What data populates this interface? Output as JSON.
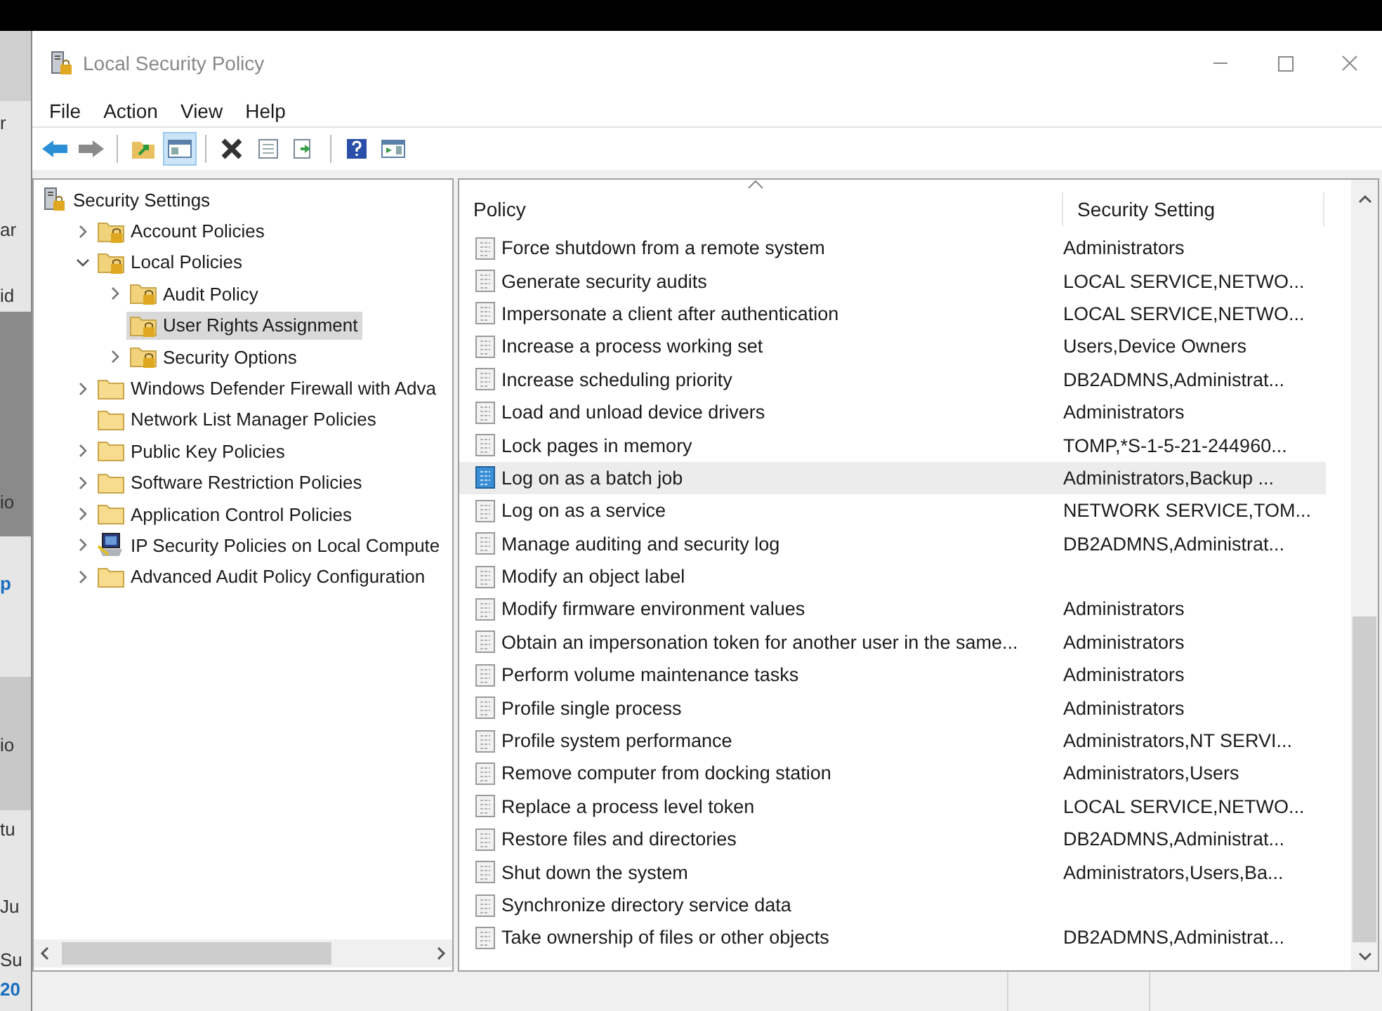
{
  "background_window": {
    "texts": [
      "r",
      "ar",
      "id",
      "io",
      "p",
      "io",
      "tu",
      "Ju",
      "Su",
      "20"
    ]
  },
  "window": {
    "title": "Local Security Policy"
  },
  "menu": [
    "File",
    "Action",
    "View",
    "Help"
  ],
  "toolbar": [
    {
      "kind": "back",
      "pressed": false
    },
    {
      "kind": "forward",
      "pressed": false
    },
    {
      "kind": "sep"
    },
    {
      "kind": "up",
      "pressed": false
    },
    {
      "kind": "tree",
      "pressed": true
    },
    {
      "kind": "sep"
    },
    {
      "kind": "delete",
      "pressed": false
    },
    {
      "kind": "properties",
      "pressed": false
    },
    {
      "kind": "export",
      "pressed": false
    },
    {
      "kind": "sep"
    },
    {
      "kind": "help",
      "pressed": false
    },
    {
      "kind": "pane",
      "pressed": false
    }
  ],
  "tree": [
    {
      "label": "Security Settings",
      "kind": "root",
      "selected": false,
      "children": [
        {
          "label": "Account Policies",
          "kind": "locked",
          "expanded": false,
          "selected": false
        },
        {
          "label": "Local Policies",
          "kind": "locked",
          "expanded": true,
          "selected": false,
          "children": [
            {
              "label": "Audit Policy",
              "kind": "locked",
              "expanded": false,
              "selected": false
            },
            {
              "label": "User Rights Assignment",
              "kind": "locked",
              "selected": true
            },
            {
              "label": "Security Options",
              "kind": "locked",
              "expanded": false,
              "selected": false
            }
          ]
        },
        {
          "label": "Windows Defender Firewall with Adva",
          "kind": "folder",
          "expanded": false,
          "selected": false
        },
        {
          "label": "Network List Manager Policies",
          "kind": "folder",
          "selected": false
        },
        {
          "label": "Public Key Policies",
          "kind": "folder",
          "expanded": false,
          "selected": false
        },
        {
          "label": "Software Restriction Policies",
          "kind": "folder",
          "expanded": false,
          "selected": false
        },
        {
          "label": "Application Control Policies",
          "kind": "folder",
          "expanded": false,
          "selected": false
        },
        {
          "label": "IP Security Policies on Local Compute",
          "kind": "ipsec",
          "expanded": false,
          "selected": false
        },
        {
          "label": "Advanced Audit Policy Configuration",
          "kind": "folder",
          "expanded": false,
          "selected": false
        }
      ]
    }
  ],
  "list": {
    "columns": [
      {
        "label": "Policy",
        "sorted": true
      },
      {
        "label": "Security Setting",
        "sorted": false
      }
    ],
    "rows": [
      {
        "policy": "Force shutdown from a remote system",
        "setting": "Administrators",
        "selected": false
      },
      {
        "policy": "Generate security audits",
        "setting": "LOCAL SERVICE,NETWO...",
        "selected": false
      },
      {
        "policy": "Impersonate a client after authentication",
        "setting": "LOCAL SERVICE,NETWO...",
        "selected": false
      },
      {
        "policy": "Increase a process working set",
        "setting": "Users,Device Owners",
        "selected": false
      },
      {
        "policy": "Increase scheduling priority",
        "setting": "DB2ADMNS,Administrat...",
        "selected": false
      },
      {
        "policy": "Load and unload device drivers",
        "setting": "Administrators",
        "selected": false
      },
      {
        "policy": "Lock pages in memory",
        "setting": "TOMP,*S-1-5-21-244960...",
        "selected": false
      },
      {
        "policy": "Log on as a batch job",
        "setting": "Administrators,Backup ...",
        "selected": true
      },
      {
        "policy": "Log on as a service",
        "setting": "NETWORK SERVICE,TOM...",
        "selected": false
      },
      {
        "policy": "Manage auditing and security log",
        "setting": "DB2ADMNS,Administrat...",
        "selected": false
      },
      {
        "policy": "Modify an object label",
        "selected": false
      },
      {
        "policy": "Modify firmware environment values",
        "setting": "Administrators",
        "selected": false
      },
      {
        "policy": "Obtain an impersonation token for another user in the same...",
        "setting": "Administrators",
        "selected": false
      },
      {
        "policy": "Perform volume maintenance tasks",
        "setting": "Administrators",
        "selected": false
      },
      {
        "policy": "Profile single process",
        "setting": "Administrators",
        "selected": false
      },
      {
        "policy": "Profile system performance",
        "setting": "Administrators,NT SERVI...",
        "selected": false
      },
      {
        "policy": "Remove computer from docking station",
        "setting": "Administrators,Users",
        "selected": false
      },
      {
        "policy": "Replace a process level token",
        "setting": "LOCAL SERVICE,NETWO...",
        "selected": false
      },
      {
        "policy": "Restore files and directories",
        "setting": "DB2ADMNS,Administrat...",
        "selected": false
      },
      {
        "policy": "Shut down the system",
        "setting": "Administrators,Users,Ba...",
        "selected": false
      },
      {
        "policy": "Synchronize directory service data",
        "selected": false
      },
      {
        "policy": "Take ownership of files or other objects",
        "setting": "DB2ADMNS,Administrat...",
        "selected": false
      }
    ]
  }
}
